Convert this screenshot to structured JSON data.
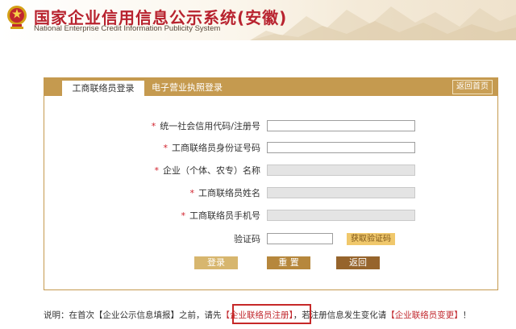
{
  "header": {
    "title": "国家企业信用信息公示系统(安徽)",
    "subtitle": "National Enterprise Credit Information Publicity System",
    "emblem_icon": "national-emblem-icon"
  },
  "colors": {
    "brand_red": "#b8232f",
    "gold": "#c59a4f",
    "required_red": "#d1202b"
  },
  "panel": {
    "tabs": [
      {
        "label": "工商联络员登录",
        "active": true
      },
      {
        "label": "电子营业执照登录",
        "active": false
      }
    ],
    "back_home_label": "返回首页"
  },
  "form": {
    "required_mark": "*",
    "fields": [
      {
        "label": "统一社会信用代码/注册号",
        "value": "",
        "disabled": false
      },
      {
        "label": "工商联络员身份证号码",
        "value": "",
        "disabled": false
      },
      {
        "label": "企业（个体、农专）名称",
        "value": "",
        "disabled": true
      },
      {
        "label": "工商联络员姓名",
        "value": "",
        "disabled": true
      },
      {
        "label": "工商联络员手机号",
        "value": "",
        "disabled": true
      }
    ],
    "captcha": {
      "label": "验证码",
      "value": "",
      "button_label": "获取验证码"
    },
    "buttons": {
      "login": "登录",
      "reset": "重 置",
      "back": "返回"
    }
  },
  "note": {
    "prefix": "说明：在首次【企业公示信息填报】之前，请先",
    "register_link": "【企业联络员注册】",
    "middle": "，若注册信息发生变化请",
    "change_link": "【企业联络员变更】",
    "suffix": "！"
  }
}
